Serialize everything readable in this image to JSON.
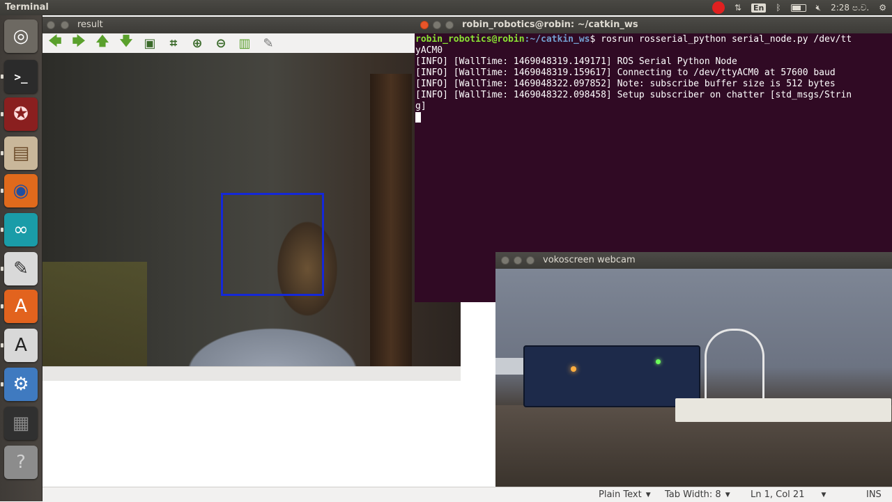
{
  "top_panel": {
    "app_title": "Terminal",
    "lang": "En",
    "clock": "2:28 ප.ව."
  },
  "launcher": {
    "items": [
      {
        "name": "ubuntu-dash-icon",
        "glyph": "◎",
        "bg": "#6d6962",
        "fg": "#ffffff"
      },
      {
        "name": "terminal-icon",
        "glyph": ">_",
        "bg": "#2b2b2b",
        "fg": "#ffffff"
      },
      {
        "name": "ros-app-icon",
        "glyph": "✪",
        "bg": "#8a1f1f",
        "fg": "#ffdddd"
      },
      {
        "name": "files-icon",
        "glyph": "▤",
        "bg": "#c9b79a",
        "fg": "#6b4b2a"
      },
      {
        "name": "firefox-icon",
        "glyph": "◉",
        "bg": "#e06a1c",
        "fg": "#1f4ea0"
      },
      {
        "name": "arduino-icon",
        "glyph": "∞",
        "bg": "#1a9ca8",
        "fg": "#ffffff"
      },
      {
        "name": "text-editor-icon",
        "glyph": "✎",
        "bg": "#d9d9d9",
        "fg": "#333333"
      },
      {
        "name": "software-center-icon",
        "glyph": "A",
        "bg": "#e2631e",
        "fg": "#ffffff"
      },
      {
        "name": "font-viewer-icon",
        "glyph": "A",
        "bg": "#d8d8d8",
        "fg": "#222222"
      },
      {
        "name": "system-settings-icon",
        "glyph": "⚙",
        "bg": "#3f7ac0",
        "fg": "#ffffff"
      },
      {
        "name": "workspace-switcher-icon",
        "glyph": "▦",
        "bg": "#303030",
        "fg": "#8a8a8a"
      },
      {
        "name": "help-icon",
        "glyph": "?",
        "bg": "#8c8c8c",
        "fg": "#d0d0d0"
      }
    ]
  },
  "result_window": {
    "title": "result"
  },
  "terminal_window": {
    "title": "robin_robotics@robin: ~/catkin_ws",
    "prompt_user": "robin_robotics@robin",
    "prompt_path": ":~/catkin_ws",
    "prompt_rest": "$ rosrun rosserial_python serial_node.py /dev/tt",
    "prompt_wrap": "yACM0",
    "lines": [
      "[INFO] [WallTime: 1469048319.149171] ROS Serial Python Node",
      "[INFO] [WallTime: 1469048319.159617] Connecting to /dev/ttyACM0 at 57600 baud",
      "[INFO] [WallTime: 1469048322.097852] Note: subscribe buffer size is 512 bytes",
      "[INFO] [WallTime: 1469048322.098458] Setup subscriber on chatter [std_msgs/Strin",
      "g]"
    ]
  },
  "voko_window": {
    "title": "vokoscreen webcam"
  },
  "statusbar": {
    "lang_mode": "Plain Text",
    "tab_width": "Tab Width: 8",
    "position": "Ln 1, Col 21",
    "mode": "INS"
  }
}
